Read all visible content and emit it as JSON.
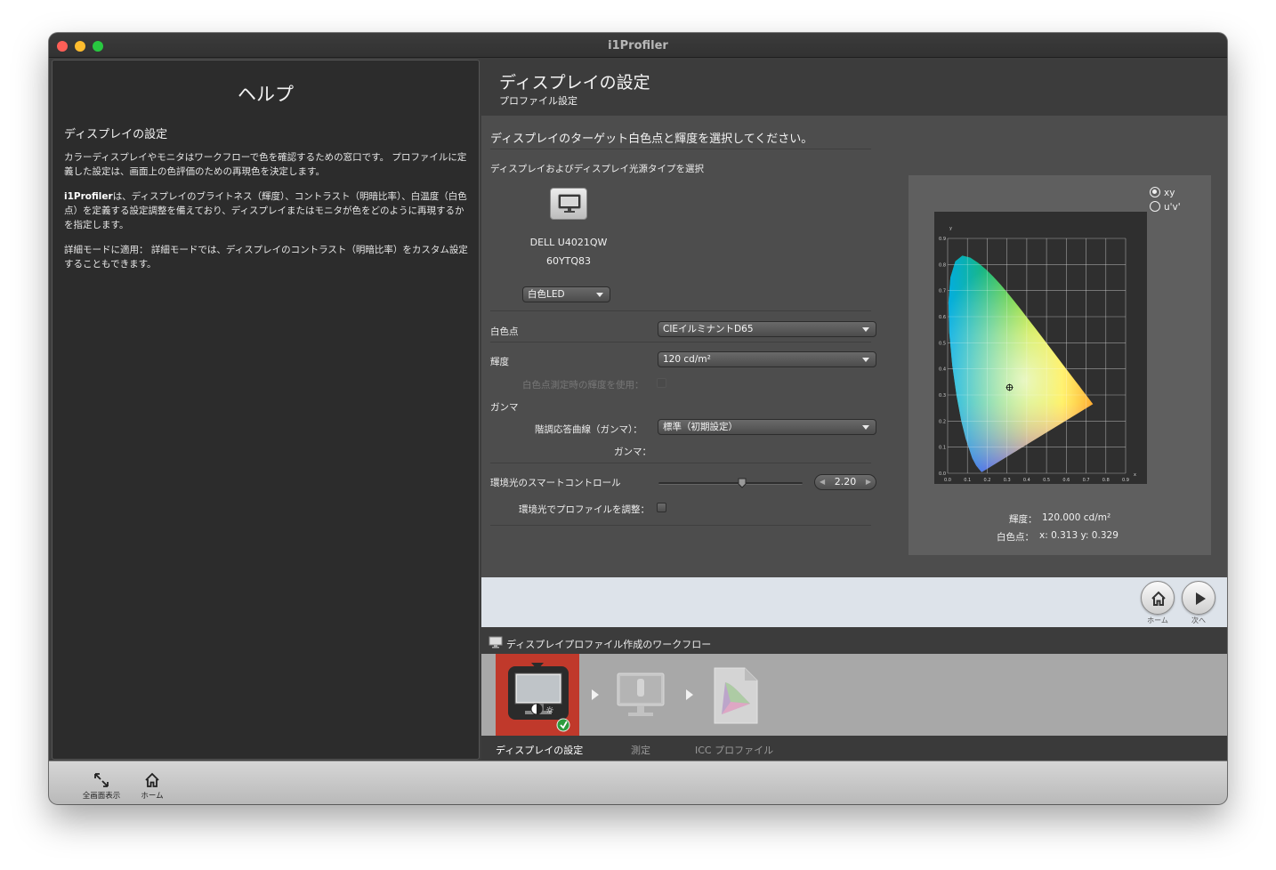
{
  "window": {
    "title": "i1Profiler"
  },
  "help": {
    "title": "ヘルプ",
    "subtitle": "ディスプレイの設定",
    "p1": "カラーディスプレイやモニタはワークフローで色を確認するための窓口です。 プロファイルに定義した設定は、画面上の色評価のための再現色を決定します。",
    "p2_bold": "i1Profiler",
    "p2": "は、ディスプレイのブライトネス（輝度）、コントラスト（明暗比率）、白温度（白色点）を定義する設定調整を備えており、ディスプレイまたはモニタが色をどのように再現するかを指定します。",
    "p3": "詳細モードに適用： 詳細モードでは、ディスプレイのコントラスト（明暗比率）をカスタム設定することもできます。"
  },
  "header": {
    "title": "ディスプレイの設定",
    "subtitle": "プロファイル設定"
  },
  "form": {
    "instruction": "ディスプレイのターゲット白色点と輝度を選択してください。",
    "display_type_label": "ディスプレイおよびディスプレイ光源タイプを選択",
    "device_model": "DELL U4021QW",
    "device_serial": "60YTQ83",
    "backlight_value": "白色LED",
    "whitepoint_label": "白色点",
    "whitepoint_value": "CIEイルミナントD65",
    "luminance_label": "輝度",
    "luminance_value": "120 cd/m²",
    "use_measured_label": "白色点測定時の輝度を使用：",
    "gamma_section": "ガンマ",
    "tone_curve_label": "階調応答曲線（ガンマ）：",
    "tone_curve_value": "標準（初期設定）",
    "gamma_label": "ガンマ：",
    "gamma_value": "2.20",
    "gamma_slider_fraction": 0.58,
    "ambient_section": "環境光のスマートコントロール",
    "ambient_adjust_label": "環境光でプロファイルを調整："
  },
  "chart": {
    "radio_xy": "xy",
    "radio_uv": "u'v'",
    "luminance_label": "輝度：",
    "luminance_value": "120.000 cd/m²",
    "whitepoint_label": "白色点：",
    "whitepoint_value": "x: 0.313  y: 0.329"
  },
  "chart_data": {
    "type": "scatter",
    "title": "",
    "xlabel": "x",
    "ylabel": "y",
    "xlim": [
      0,
      0.9
    ],
    "ylim": [
      0,
      0.9
    ],
    "x_ticks": [
      "0.0",
      "0.1",
      "0.2",
      "0.3",
      "0.4",
      "0.5",
      "0.6",
      "0.7",
      "0.8",
      "0.9"
    ],
    "y_ticks": [
      "0.0",
      "0.1",
      "0.2",
      "0.3",
      "0.4",
      "0.5",
      "0.6",
      "0.7",
      "0.8",
      "0.9"
    ],
    "grid": true,
    "points": [
      {
        "x": 0.313,
        "y": 0.329
      }
    ]
  },
  "nav": {
    "home_label": "ホーム",
    "next_label": "次へ"
  },
  "workflow": {
    "title": "ディスプレイプロファイル作成のワークフロー",
    "steps": [
      "ディスプレイの設定",
      "測定",
      "ICC プロファイル"
    ]
  },
  "bottom": {
    "fullscreen_label": "全画面表示",
    "home_label": "ホーム"
  },
  "colors": {
    "active_step": "#c0392b",
    "panel": "#4d4d4d",
    "help_bg": "#2c2c2c"
  }
}
